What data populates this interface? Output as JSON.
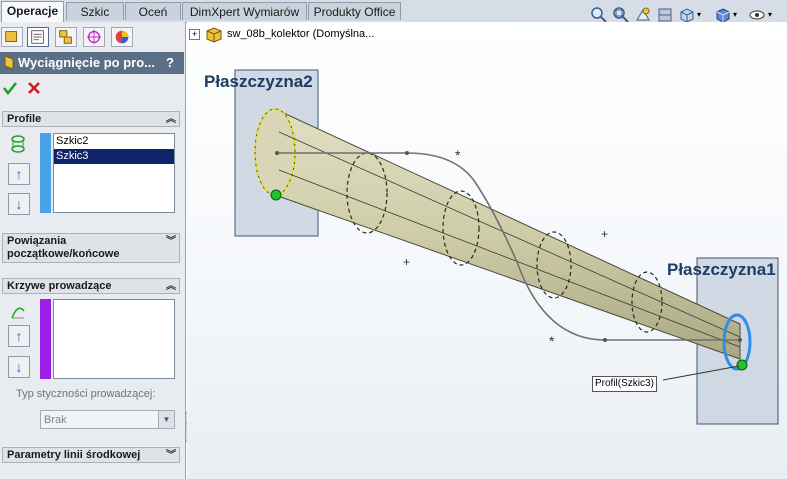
{
  "tabs": [
    {
      "label": "Operacje",
      "active": true
    },
    {
      "label": "Szkic",
      "active": false
    },
    {
      "label": "Oceń",
      "active": false
    },
    {
      "label": "DimXpert Wymiarów",
      "active": false
    },
    {
      "label": "Produkty Office",
      "active": false
    }
  ],
  "toolbar": {
    "icons": [
      "zoom-to-fit-icon",
      "zoom-to-area-icon",
      "previous-view-icon",
      "section-view-icon",
      "view-orientation-icon",
      "display-style-icon",
      "hide-show-items-icon"
    ]
  },
  "panel": {
    "icons": [
      "feature-manager-icon",
      "property-manager-icon",
      "configuration-manager-icon",
      "dimxpert-manager-icon",
      "display-manager-icon"
    ],
    "title": "Wyciągnięcie po pro...",
    "help": "?",
    "ok_icon": "checkmark-icon",
    "cancel_icon": "cross-icon",
    "profile": {
      "header": "Profile",
      "items": [
        "Szkic2",
        "Szkic3"
      ],
      "selected": "Szkic3"
    },
    "constraints": {
      "line1": "Powiązania",
      "line2": "początkowe/końcowe"
    },
    "guides": {
      "header": "Krzywe prowadzące",
      "tangency_label": "Typ styczności prowadzącej:",
      "tangency_value": "Brak"
    },
    "centerline": {
      "header": "Parametry linii środkowej"
    }
  },
  "tree": {
    "item": "sw_08b_kolektor  (Domyślna..."
  },
  "viewport": {
    "plane2_label": "Płaszczyzna2",
    "plane1_label": "Płaszczyzna1",
    "callout": "Profil(Szkic3)"
  },
  "colors": {
    "tab_bar": "#d6dde6",
    "panel_bg": "#e8ebef",
    "title_bar": "#5b6f86",
    "selection": "#10246a",
    "profile_bar": "#4aa3e8",
    "guide_bar": "#9b1fe8",
    "loft_body": "#d4d2b0",
    "plane": "#c9d3df",
    "plane_label": "#1c3d66"
  }
}
